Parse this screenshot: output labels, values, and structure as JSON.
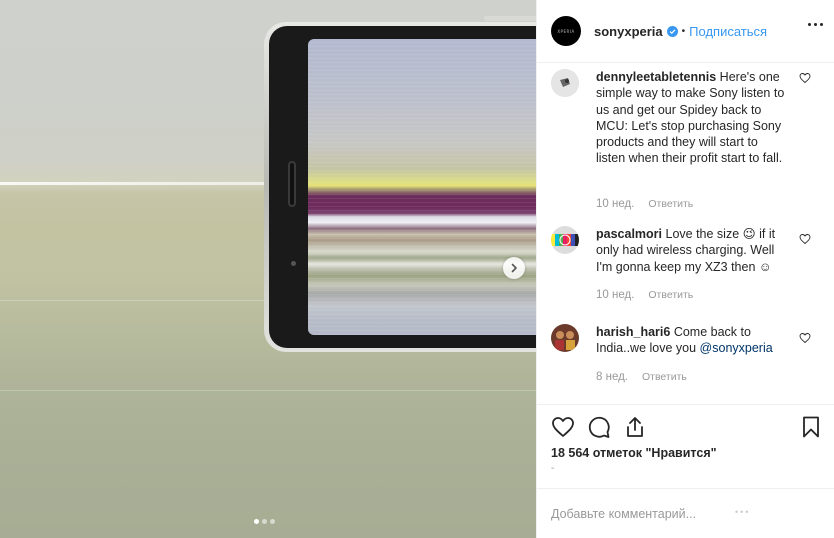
{
  "header": {
    "logo_text": "XPERIA",
    "username": "sonyxperia",
    "separator": "•",
    "follow_label": "Подписаться"
  },
  "comments": [
    {
      "username": "dennyleetabletennis",
      "text": "Here's one simple way to make Sony listen to us and get our Spidey back to MCU: Let's stop purchasing Sony products and they will start to listen when their profit start to fall.",
      "time": "10 нед.",
      "reply_label": "Ответить"
    },
    {
      "username": "pascalmori",
      "text": "Love the size 😉 if it only had wireless charging. Well I'm gonna keep my XZ3 then ☺",
      "time": "10 нед.",
      "reply_label": "Ответить"
    },
    {
      "username": "harish_hari6",
      "text": "Come back to India..we love you",
      "mention": "@sonyxperia",
      "time": "8 нед.",
      "reply_label": "Ответить"
    }
  ],
  "actions": {
    "likes_text": "18 564 отметок \"Нравится\"",
    "date_placeholder": "-"
  },
  "add_comment": {
    "placeholder": "Добавьте комментарий..."
  },
  "carousel": {
    "slides": 3,
    "active_index": 0
  },
  "colors": {
    "accent": "#3897f0",
    "text": "#262626",
    "muted": "#999999",
    "mention": "#003569"
  }
}
